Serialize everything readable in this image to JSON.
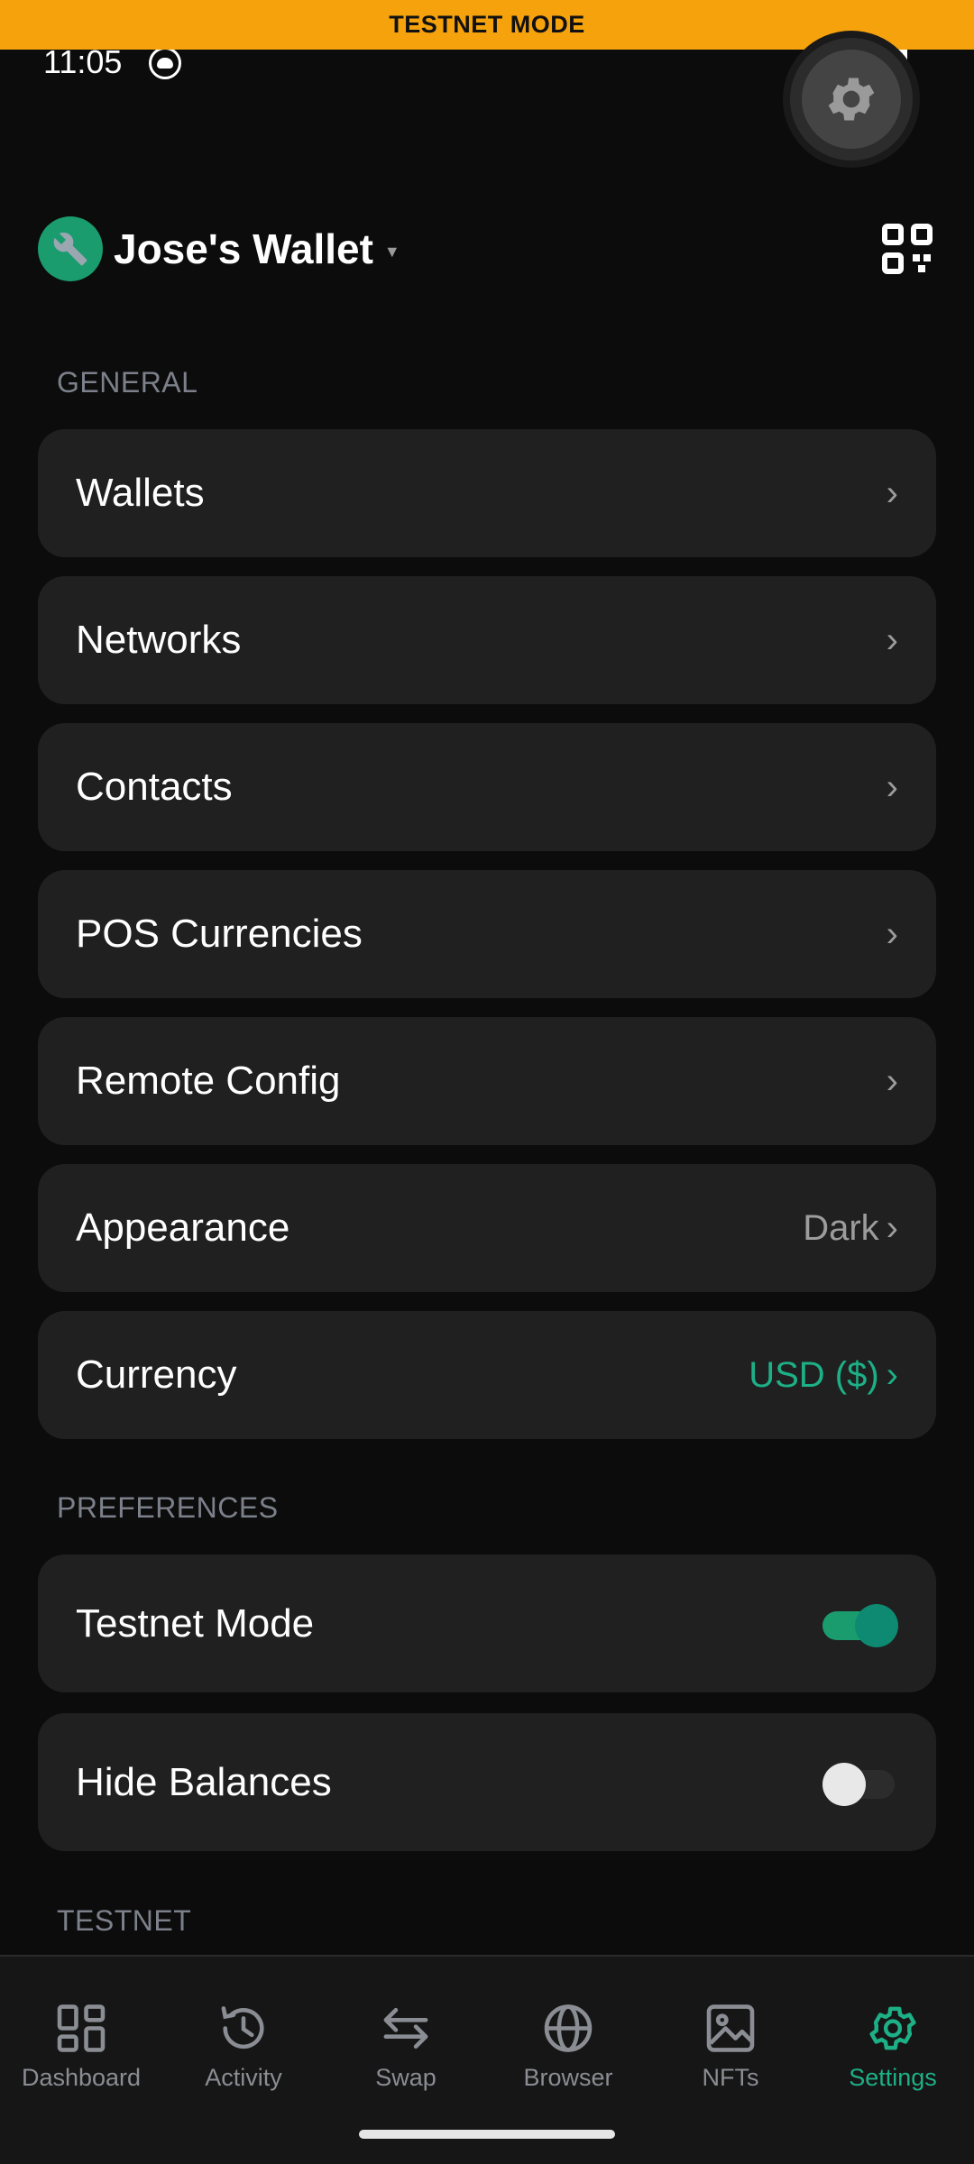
{
  "banner": {
    "text": "TESTNET MODE"
  },
  "status_bar": {
    "time": "11:05"
  },
  "header": {
    "wallet_name": "Jose's Wallet"
  },
  "sections": {
    "general": "GENERAL",
    "preferences": "PREFERENCES",
    "testnet": "TESTNET"
  },
  "general_items": [
    {
      "label": "Wallets"
    },
    {
      "label": "Networks"
    },
    {
      "label": "Contacts"
    },
    {
      "label": "POS Currencies"
    },
    {
      "label": "Remote Config"
    },
    {
      "label": "Appearance",
      "value": "Dark"
    },
    {
      "label": "Currency",
      "value": "USD ($)"
    }
  ],
  "preferences": [
    {
      "label": "Testnet Mode",
      "enabled": true
    },
    {
      "label": "Hide Balances",
      "enabled": false
    }
  ],
  "chevron": "›",
  "bottom_nav": [
    {
      "label": "Dashboard",
      "icon": "dashboard-icon"
    },
    {
      "label": "Activity",
      "icon": "history-icon"
    },
    {
      "label": "Swap",
      "icon": "swap-icon"
    },
    {
      "label": "Browser",
      "icon": "globe-icon"
    },
    {
      "label": "NFTs",
      "icon": "image-icon"
    },
    {
      "label": "Settings",
      "icon": "gear-icon",
      "active": true
    }
  ],
  "colors": {
    "accent": "#1db087",
    "banner": "#f5a20d",
    "background": "#0c0c0c",
    "row_background": "#202020"
  }
}
